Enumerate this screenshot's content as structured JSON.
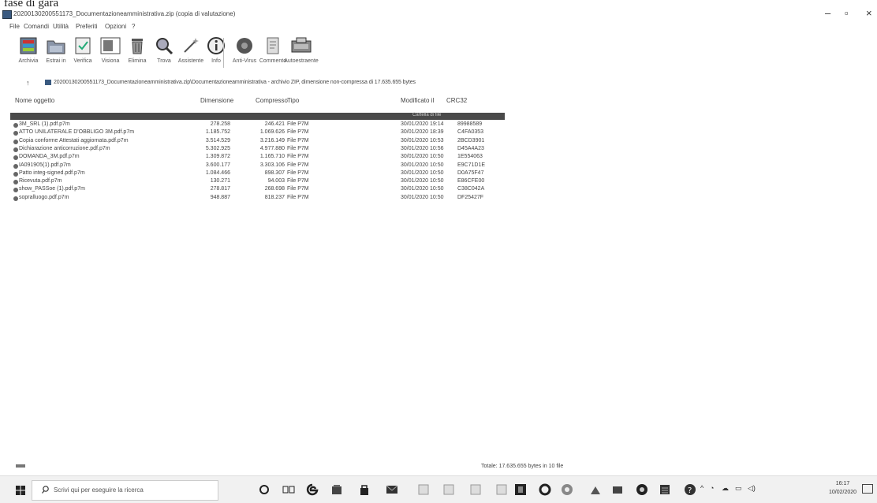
{
  "caption": "fase di gara",
  "window": {
    "title": "20200130200551173_Documentazioneamministrativa.zip (copia di valutazione)",
    "minimize": "–",
    "maximize": "▫",
    "close": "×"
  },
  "menu": [
    "File",
    "Comandi",
    "Utilità",
    "Preferiti",
    "Opzioni",
    "?"
  ],
  "toolbar": [
    {
      "label": "Archivia",
      "icon": "archive-icon"
    },
    {
      "label": "Estrai in",
      "icon": "extract-folder-icon"
    },
    {
      "label": "Verifica",
      "icon": "test-icon"
    },
    {
      "label": "Visiona",
      "icon": "view-icon"
    },
    {
      "label": "Elimina",
      "icon": "trash-icon"
    },
    {
      "label": "Trova",
      "icon": "find-icon"
    },
    {
      "label": "Assistente",
      "icon": "wizard-icon"
    },
    {
      "label": "Info",
      "icon": "info-icon"
    },
    {
      "label": "Anti-Virus",
      "icon": "antivirus-icon"
    },
    {
      "label": "Commento",
      "icon": "comment-icon"
    },
    {
      "label": "Autoestraente",
      "icon": "sfx-icon"
    }
  ],
  "address": {
    "up": "↑",
    "path": "20200130200551173_Documentazioneamministrativa.zip\\Documentazioneamministrativa - archivio ZIP, dimensione non-compressa di 17.635.655 bytes"
  },
  "columns": {
    "name": "Nome oggetto",
    "size": "Dimensione",
    "packed": "Compresso",
    "type": "Tipo",
    "modified": "Modificato il",
    "crc": "CRC32"
  },
  "up_row_label": "Cartella di file",
  "files": [
    {
      "name": "3M_SRL (1).pdf.p7m",
      "size": "278.258",
      "packed": "246.421",
      "type": "File P7M",
      "modified": "30/01/2020 19:14",
      "crc": "89988589"
    },
    {
      "name": "ATTO UNILATERALE D'OBBLIGO 3M.pdf.p7m",
      "size": "1.185.752",
      "packed": "1.069.626",
      "type": "File P7M",
      "modified": "30/01/2020 18:39",
      "crc": "C4FA0353"
    },
    {
      "name": "Copia conforme Attestati aggiornata.pdf.p7m",
      "size": "3.514.529",
      "packed": "3.216.149",
      "type": "File P7M",
      "modified": "30/01/2020 10:53",
      "crc": "2BCD3901"
    },
    {
      "name": "Dichiarazione anticorruzione.pdf.p7m",
      "size": "5.302.925",
      "packed": "4.977.880",
      "type": "File P7M",
      "modified": "30/01/2020 10:56",
      "crc": "D45A4A23"
    },
    {
      "name": "DOMANDA_3M.pdf.p7m",
      "size": "1.309.872",
      "packed": "1.165.710",
      "type": "File P7M",
      "modified": "30/01/2020 10:50",
      "crc": "1E554063"
    },
    {
      "name": "IA091905(1).pdf.p7m",
      "size": "3.600.177",
      "packed": "3.303.106",
      "type": "File P7M",
      "modified": "30/01/2020 10:50",
      "crc": "E9C71D1E"
    },
    {
      "name": "Patto integ-signed.pdf.p7m",
      "size": "1.084.466",
      "packed": "898.307",
      "type": "File P7M",
      "modified": "30/01/2020 10:50",
      "crc": "D0A75F47"
    },
    {
      "name": "Ricevuta.pdf.p7m",
      "size": "130.271",
      "packed": "94.003",
      "type": "File P7M",
      "modified": "30/01/2020 10:50",
      "crc": "E86CFE00"
    },
    {
      "name": "show_PASSoe (1).pdf.p7m",
      "size": "278.817",
      "packed": "268.698",
      "type": "File P7M",
      "modified": "30/01/2020 10:50",
      "crc": "C38C042A"
    },
    {
      "name": "sopralluogo.pdf.p7m",
      "size": "948.887",
      "packed": "818.237",
      "type": "File P7M",
      "modified": "30/01/2020 10:50",
      "crc": "DF25427F"
    }
  ],
  "status": {
    "totals": "Totale: 17.635.655 bytes in 10 file"
  },
  "taskbar": {
    "search_placeholder": "Scrivi qui per eseguire la ricerca",
    "time": "16:17",
    "date": "10/02/2020"
  }
}
